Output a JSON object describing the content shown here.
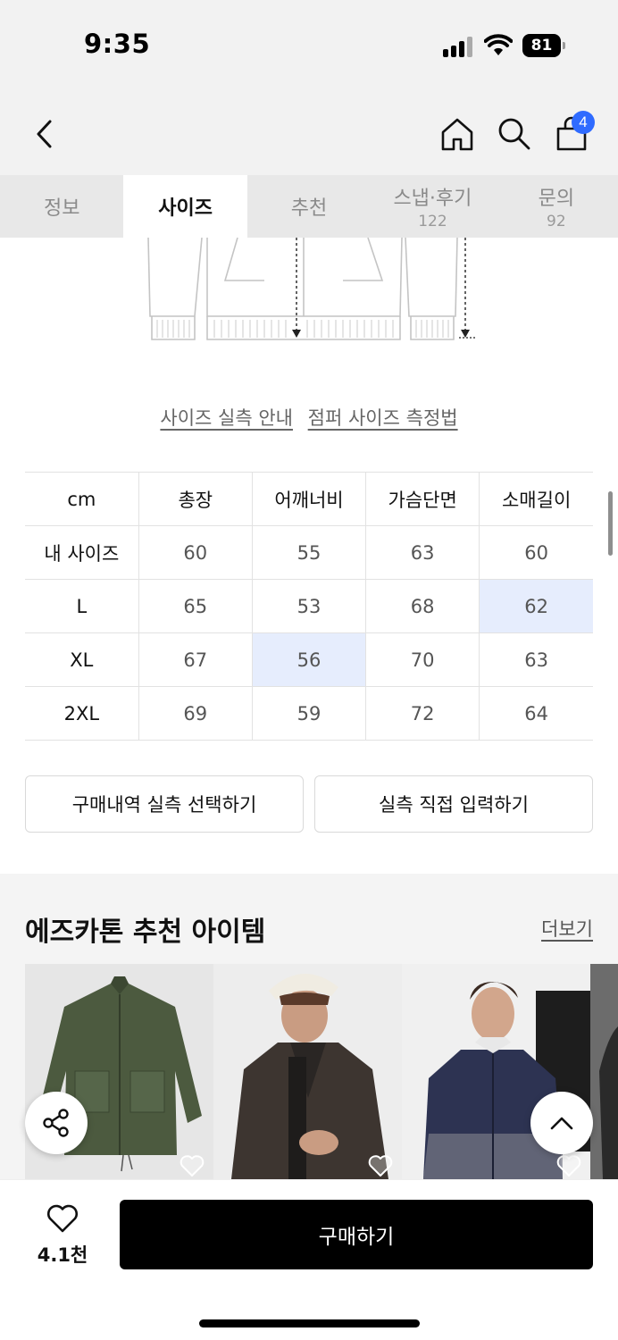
{
  "status_bar": {
    "time": "9:35",
    "battery": "81"
  },
  "nav": {
    "cart_count": "4"
  },
  "tabs": [
    {
      "label": "정보",
      "count": ""
    },
    {
      "label": "사이즈",
      "count": ""
    },
    {
      "label": "추천",
      "count": ""
    },
    {
      "label": "스냅·후기",
      "count": "122"
    },
    {
      "label": "문의",
      "count": "92"
    }
  ],
  "active_tab": "사이즈",
  "size_links": {
    "guide": "사이즈 실측 안내",
    "measure": "점퍼 사이즈 측정법"
  },
  "size_table": {
    "headers": [
      "cm",
      "총장",
      "어깨너비",
      "가슴단면",
      "소매길이"
    ],
    "rows": [
      {
        "label": "내 사이즈",
        "values": [
          "60",
          "55",
          "63",
          "60"
        ]
      },
      {
        "label": "L",
        "values": [
          "65",
          "53",
          "68",
          "62"
        ]
      },
      {
        "label": "XL",
        "values": [
          "67",
          "56",
          "70",
          "63"
        ]
      },
      {
        "label": "2XL",
        "values": [
          "69",
          "59",
          "72",
          "64"
        ]
      }
    ],
    "highlight_color": "#e6edfd"
  },
  "actions": {
    "select_history": "구매내역 실측 선택하기",
    "direct_input": "실측 직접 입력하기"
  },
  "recommend": {
    "title": "에즈카톤 추천 아이템",
    "more": "더보기"
  },
  "bottom": {
    "like_count": "4.1천",
    "buy_label": "구매하기"
  },
  "colors": {
    "accent_badge": "#2f6bff",
    "buy_button": "#000000",
    "tab_bar_bg": "#e8e8e8"
  },
  "icons": [
    "back-icon",
    "home-icon",
    "search-icon",
    "cart-icon",
    "share-icon",
    "chevron-up-icon",
    "heart-icon"
  ]
}
